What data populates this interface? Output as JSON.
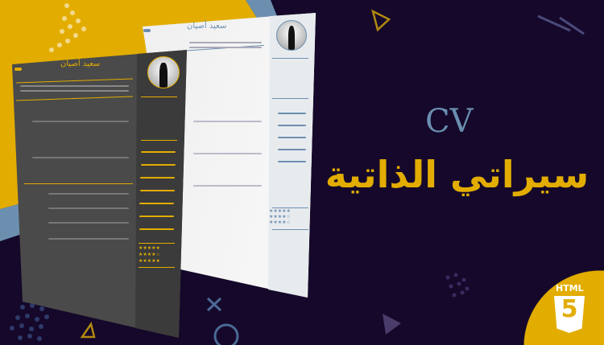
{
  "banner": {
    "title": "CV",
    "subtitle": "سيراتي الذاتية"
  },
  "cv_preview_dark": {
    "name": "سعيد أصيان",
    "accent_color": "#e2ad00"
  },
  "cv_preview_light": {
    "name": "سعيد أصيان",
    "accent_color": "#6c8fb0"
  },
  "badge": {
    "label": "HTML",
    "number": "5",
    "icon": "html5-icon"
  },
  "colors": {
    "background": "#15082a",
    "yellow": "#e2ad00",
    "blue": "#6c8fb0"
  }
}
